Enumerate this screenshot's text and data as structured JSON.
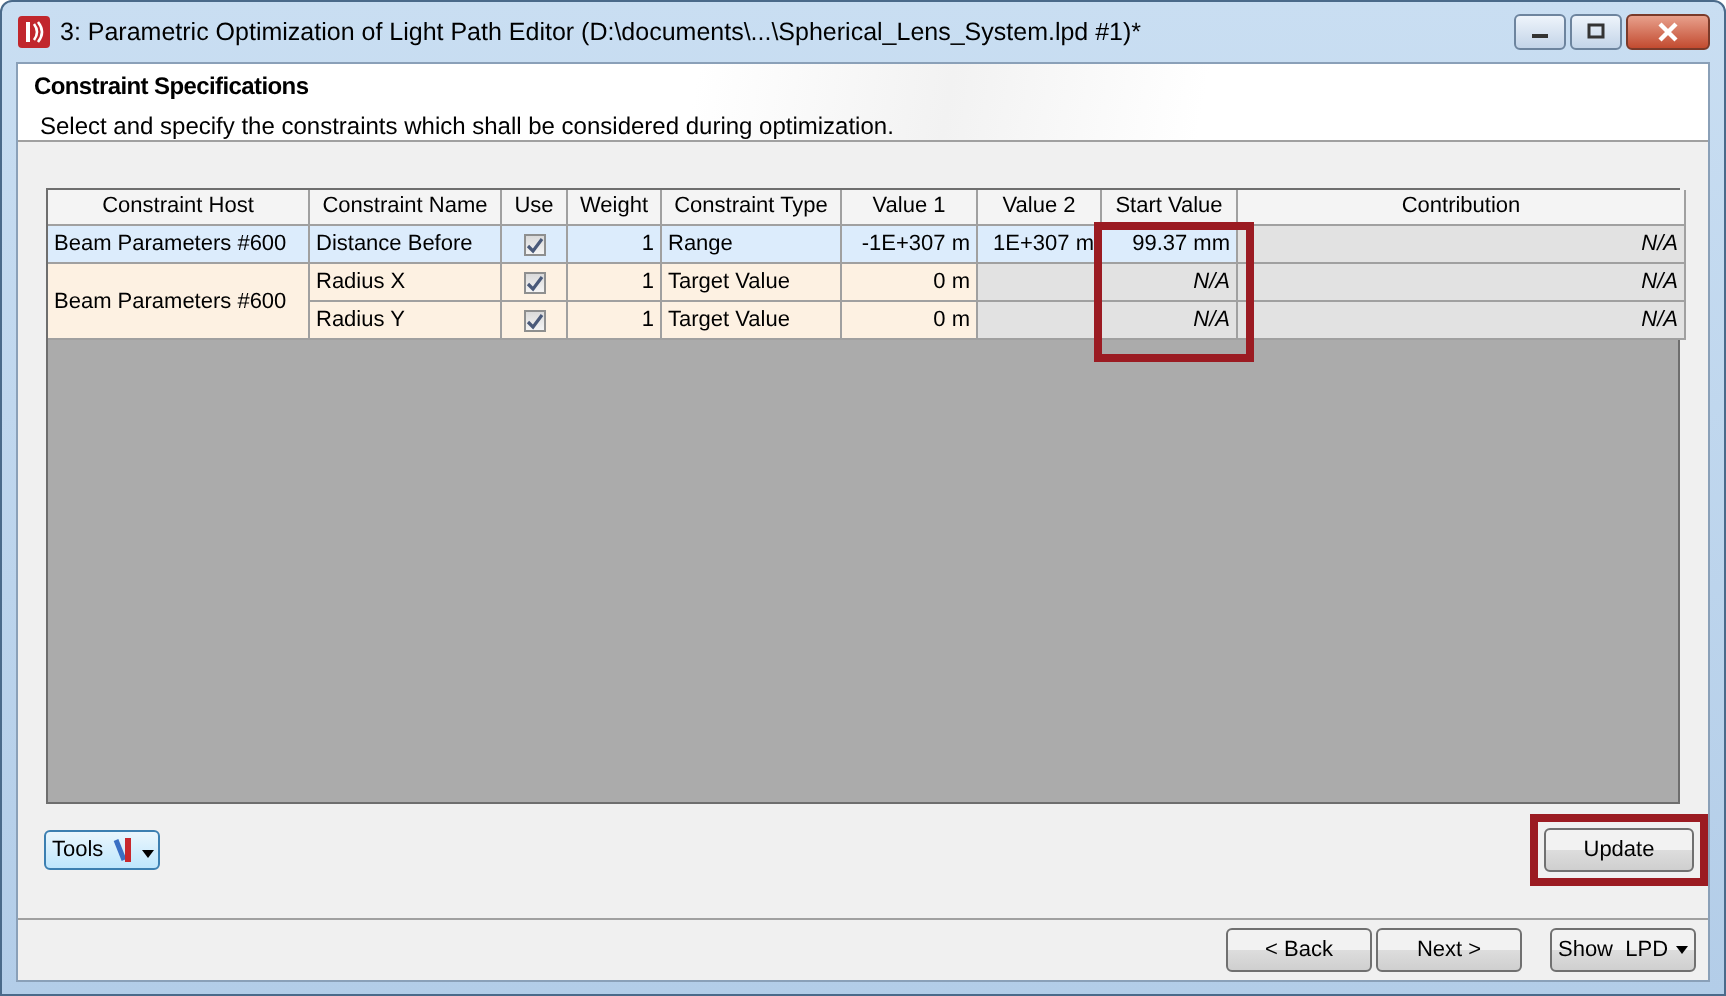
{
  "window": {
    "title": "3: Parametric Optimization of Light Path Editor (D:\\documents\\...\\Spherical_Lens_System.lpd #1)*"
  },
  "header": {
    "title": "Constraint Specifications",
    "description": "Select and specify the constraints which shall be considered during optimization."
  },
  "table": {
    "columns": [
      {
        "label": "Constraint Host",
        "highlighted": false
      },
      {
        "label": "Constraint Name",
        "highlighted": false
      },
      {
        "label": "Use",
        "highlighted": false
      },
      {
        "label": "Weight",
        "highlighted": false
      },
      {
        "label": "Constraint Type",
        "highlighted": false
      },
      {
        "label": "Value 1",
        "highlighted": false
      },
      {
        "label": "Value 2",
        "highlighted": false
      },
      {
        "label": "Start Value",
        "highlighted": true
      },
      {
        "label": "Contribution",
        "highlighted": false
      }
    ],
    "groups": [
      {
        "host": "Beam Parameters #600",
        "selected": true,
        "rows": [
          {
            "name": "Distance Before",
            "use": true,
            "weight": "1",
            "type": "Range",
            "value1": "-1E+307 m",
            "value2": "1E+307 m",
            "start": "99.37 mm",
            "start_available": true,
            "contribution": "N/A"
          }
        ]
      },
      {
        "host": "Beam Parameters #600",
        "selected": false,
        "rows": [
          {
            "name": "Radius X",
            "use": true,
            "weight": "1",
            "type": "Target Value",
            "value1": "0 m",
            "start": "N/A",
            "start_available": false,
            "contribution": "N/A"
          },
          {
            "name": "Radius Y",
            "use": true,
            "weight": "1",
            "type": "Target Value",
            "value1": "0 m",
            "start": "N/A",
            "start_available": false,
            "contribution": "N/A"
          }
        ]
      }
    ]
  },
  "tools_button": {
    "label": "Tools"
  },
  "update_button": {
    "label": "Update",
    "highlighted": true
  },
  "nav": {
    "back": "< Back",
    "next": "Next >",
    "show": "Show  LPD"
  }
}
